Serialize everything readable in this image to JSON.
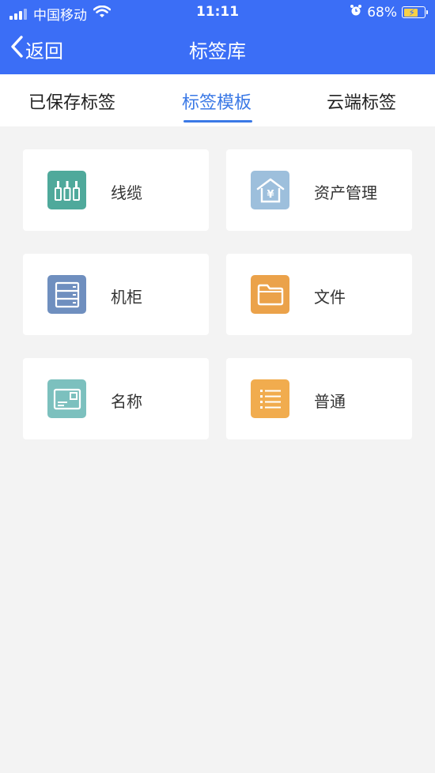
{
  "status_bar": {
    "carrier": "中国移动",
    "time": "11:11",
    "battery": "68%",
    "battery_level": 0.68,
    "icons": [
      "signal-icon",
      "wifi-icon",
      "alarm-icon",
      "battery-icon"
    ]
  },
  "nav": {
    "back_label": "返回",
    "title": "标签库",
    "background_color": "#3b6ef6"
  },
  "tabs": [
    {
      "label": "已保存标签",
      "active": false
    },
    {
      "label": "标签模板",
      "active": true
    },
    {
      "label": "云端标签",
      "active": false
    }
  ],
  "accent_color": "#3b79e6",
  "templates": [
    {
      "label": "线缆",
      "icon": "cable-icon",
      "color": "#4fa99b"
    },
    {
      "label": "资产管理",
      "icon": "asset-house-icon",
      "color": "#9dbfdc"
    },
    {
      "label": "机柜",
      "icon": "cabinet-icon",
      "color": "#6f8fbf"
    },
    {
      "label": "文件",
      "icon": "folder-icon",
      "color": "#eba24a"
    },
    {
      "label": "名称",
      "icon": "name-card-icon",
      "color": "#7cc0be"
    },
    {
      "label": "普通",
      "icon": "list-icon",
      "color": "#f1ac4e"
    }
  ]
}
